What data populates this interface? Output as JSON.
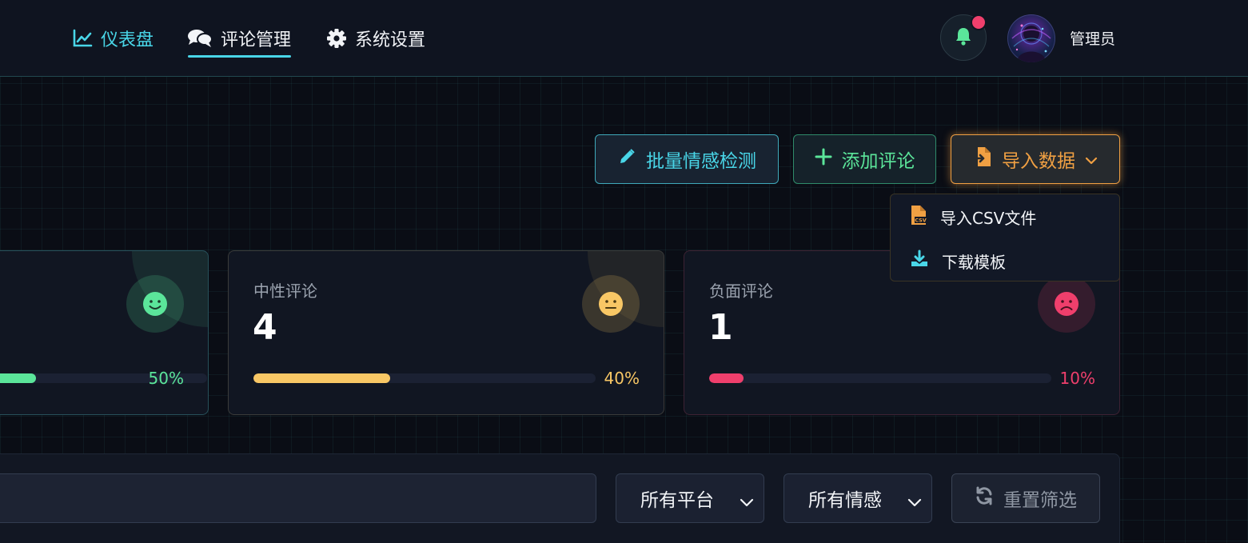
{
  "nav": {
    "items": [
      {
        "label": "仪表盘",
        "icon": "chart-line-icon",
        "active": false
      },
      {
        "label": "评论管理",
        "icon": "comments-icon",
        "active": true
      },
      {
        "label": "系统设置",
        "icon": "gear-icon",
        "active": false
      }
    ],
    "username": "管理员",
    "notification_dot": true
  },
  "actions": {
    "batch_label": "批量情感检测",
    "add_label": "添加评论",
    "import_label": "导入数据",
    "import_menu": [
      {
        "label": "导入CSV文件",
        "icon": "csv-file-icon"
      },
      {
        "label": "下载模板",
        "icon": "download-icon"
      }
    ]
  },
  "stats": {
    "positive": {
      "label": "",
      "value": "",
      "percent_label": "50%",
      "percent": 50,
      "color": "#5be59a"
    },
    "neutral": {
      "label": "中性评论",
      "value": "4",
      "percent_label": "40%",
      "percent": 40,
      "color": "#f8c765"
    },
    "negative": {
      "label": "负面评论",
      "value": "1",
      "percent_label": "10%",
      "percent": 10,
      "color": "#ef3f6c"
    }
  },
  "filters": {
    "search_placeholder": "",
    "platform": "所有平台",
    "sentiment": "所有情感",
    "reset_label": "重置筛选"
  },
  "colors": {
    "accent_cyan": "#49d6e8",
    "accent_green": "#5be59a",
    "accent_orange": "#f0a043",
    "accent_red": "#ef3f6c",
    "accent_yellow": "#f8c765"
  }
}
